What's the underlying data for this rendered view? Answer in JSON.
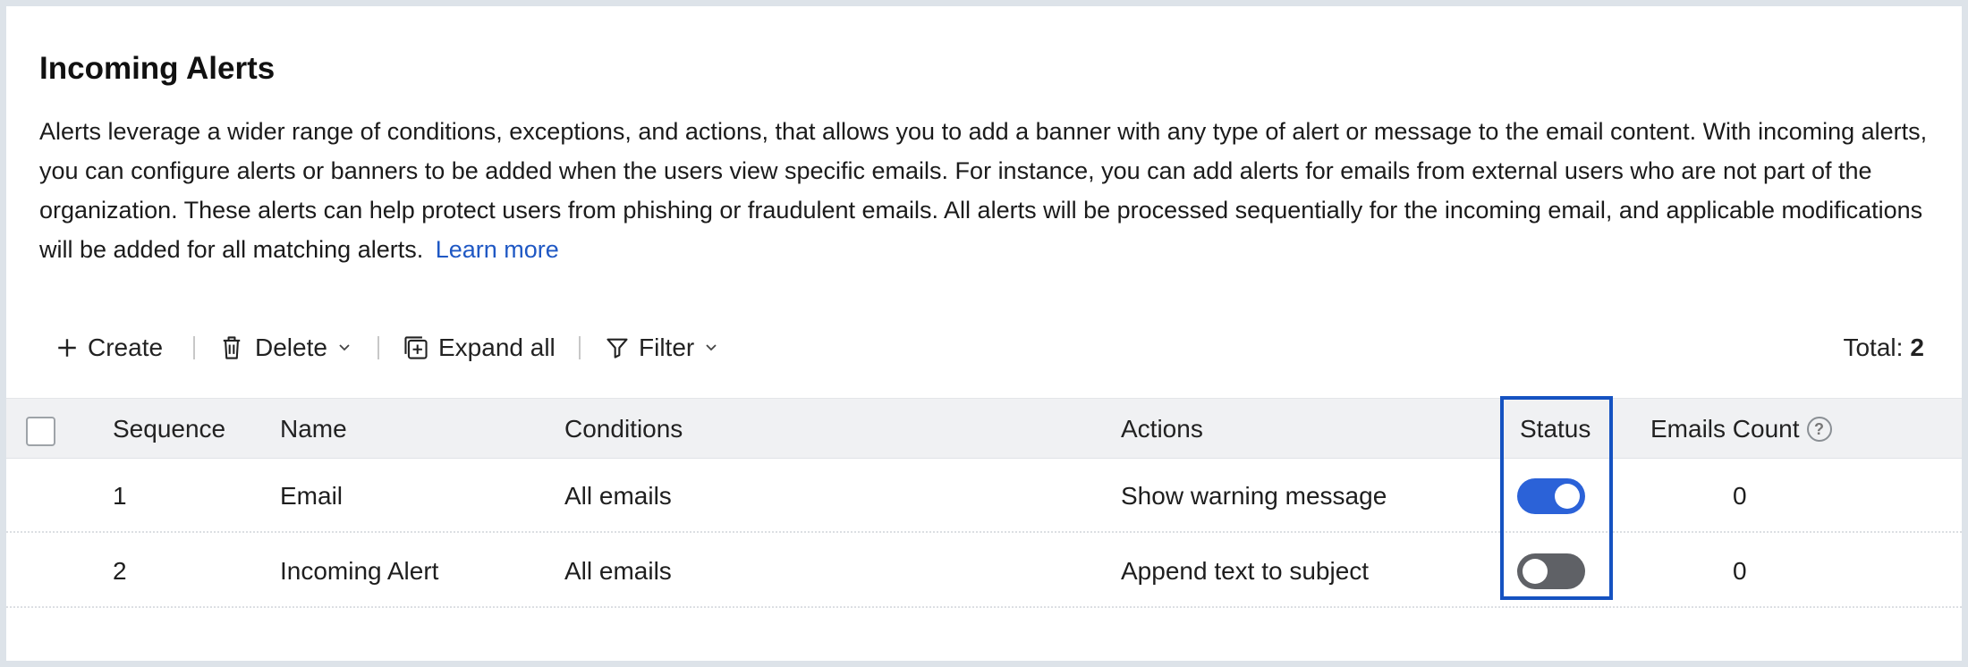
{
  "page": {
    "title": "Incoming Alerts",
    "description": "Alerts leverage a wider range of conditions, exceptions, and actions, that allows you to add a banner with any type of alert or message to the email content. With incoming alerts, you can configure alerts or banners to be added when the users view specific emails. For instance, you can add alerts for emails from external users who are not part of the organization. These alerts can help protect users from phishing or fraudulent emails. All alerts will be processed sequentially for the incoming email, and applicable modifications will be added for all matching alerts.",
    "learn_more": "Learn more"
  },
  "toolbar": {
    "create": "Create",
    "delete": "Delete",
    "expand_all": "Expand all",
    "filter": "Filter",
    "total_label": "Total:",
    "total_value": "2"
  },
  "table": {
    "headers": {
      "sequence": "Sequence",
      "name": "Name",
      "conditions": "Conditions",
      "actions": "Actions",
      "status": "Status",
      "emails_count": "Emails Count",
      "help_glyph": "?"
    },
    "rows": [
      {
        "sequence": "1",
        "name": "Email",
        "conditions": "All emails",
        "actions": "Show warning message",
        "status": "on",
        "emails_count": "0"
      },
      {
        "sequence": "2",
        "name": "Incoming Alert",
        "conditions": "All emails",
        "actions": "Append text to subject",
        "status": "off",
        "emails_count": "0"
      }
    ]
  },
  "colors": {
    "accent": "#2b62d8",
    "link": "#1f58c4",
    "toggle_off": "#5f6166",
    "highlight_box": "#1552c1",
    "header_bg": "#f0f1f3"
  },
  "icons": [
    "plus-icon",
    "trash-icon",
    "chevron-down-icon",
    "expand-all-icon",
    "filter-icon",
    "help-icon"
  ]
}
